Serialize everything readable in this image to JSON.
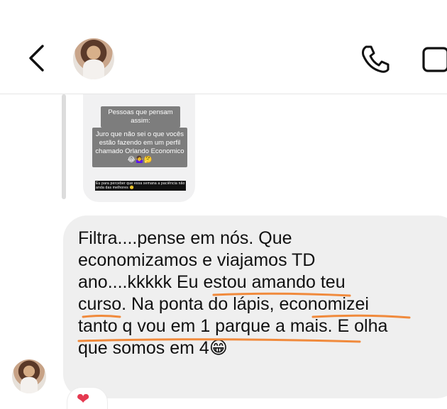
{
  "header": {
    "back_icon": "chevron-left-icon",
    "call_icon": "phone-icon",
    "video_icon": "video-camera-icon"
  },
  "story_reply": {
    "label_1": "Pessoas que pensam assim:",
    "label_2": "Juro que não sei o que vocês estão fazendo em um perfil chamado Orlando Economico 😂🤷‍♀️🤔",
    "footer": "Eu para perceber que essa semana a paciência não anda das melhores 🙂"
  },
  "message": {
    "text": "Filtra....pense em nós. Que\neconomizamos e viajamos TD\nano....kkkkk Eu estou amando teu\ncurso. Na ponta do lápis, economizei\ntanto q vou em 1 parque a mais. E olha\nque somos em 4😁",
    "underline_color": "#f08a3c"
  },
  "reaction": {
    "emoji": "❤"
  }
}
